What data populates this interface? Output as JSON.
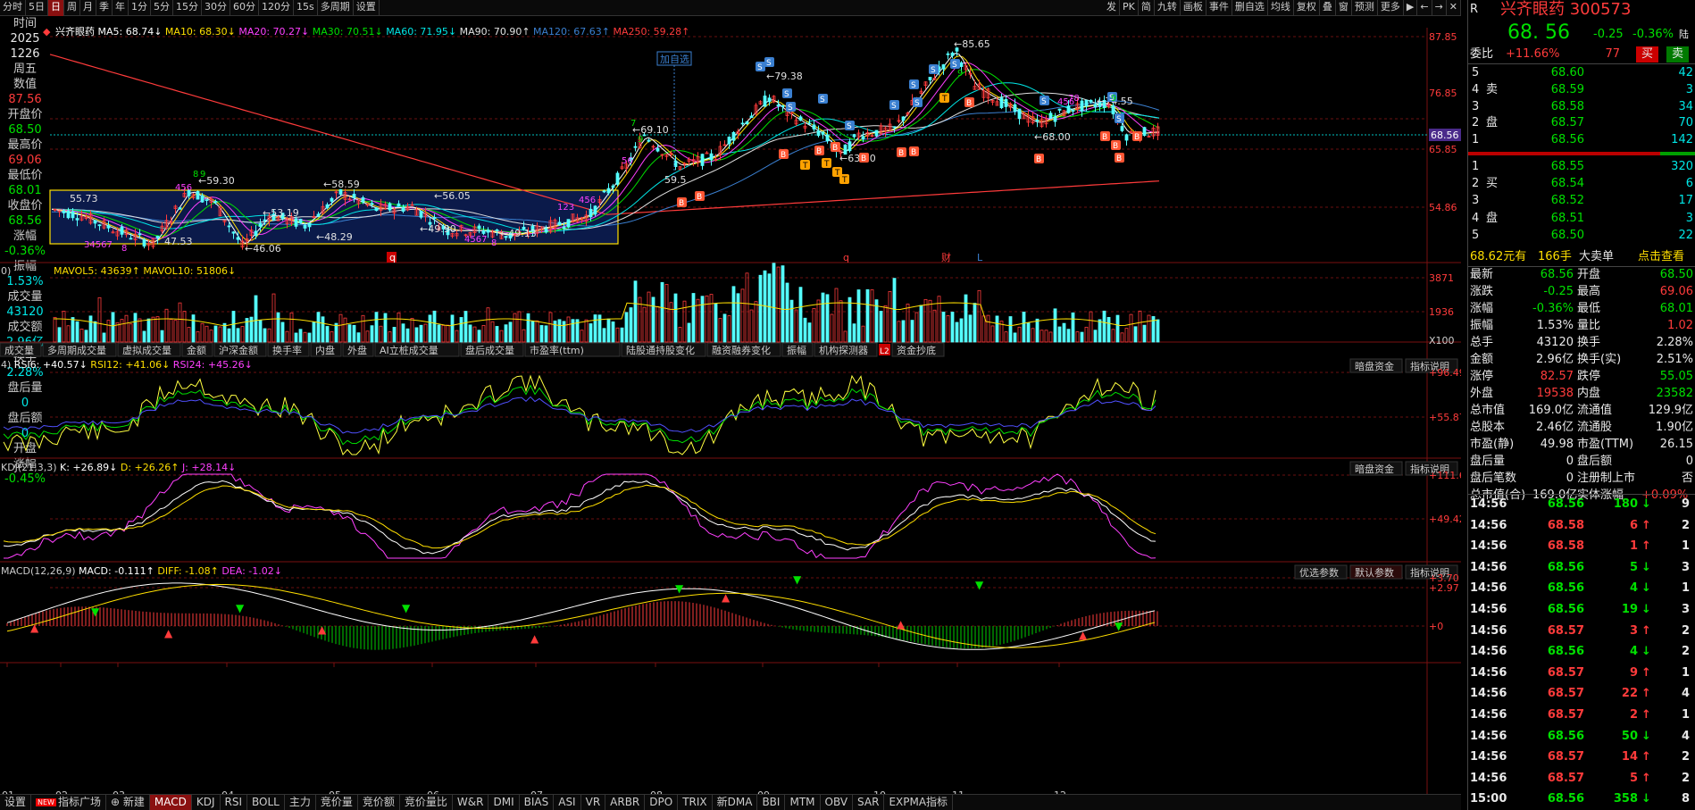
{
  "toolbar": {
    "items": [
      "分时",
      "5日",
      "日",
      "周",
      "月",
      "季",
      "年",
      "1分",
      "5分",
      "15分",
      "30分",
      "60分",
      "120分",
      "15s",
      "多周期",
      "设置"
    ],
    "active": "日",
    "right": [
      "发",
      "PK",
      "简",
      "九转",
      "画板",
      "事件",
      "删自选",
      "均线",
      "复权",
      "叠",
      "窗",
      "预测",
      "更多"
    ]
  },
  "leftcol": [
    {
      "l": "时间",
      "v": "2025"
    },
    {
      "l": "",
      "v": "1226"
    },
    {
      "l": "周五",
      "v": ""
    },
    {
      "l": "数值",
      "v": "87.56",
      "vc": "red"
    },
    {
      "l": "开盘价",
      "v": "68.50",
      "vc": "grn"
    },
    {
      "l": "最高价",
      "v": "69.06",
      "vc": "red"
    },
    {
      "l": "最低价",
      "v": "68.01",
      "vc": "grn"
    },
    {
      "l": "收盘价",
      "v": "68.56",
      "vc": "grn"
    },
    {
      "l": "涨幅",
      "v": "-0.36%",
      "vc": "grn"
    },
    {
      "l": "振幅",
      "v": "1.53%",
      "vc": "cyn"
    },
    {
      "l": "成交量",
      "v": "43120",
      "vc": "cyn"
    },
    {
      "l": "成交额",
      "v": "2.96亿",
      "vc": "cyn"
    },
    {
      "l": "换手",
      "v": "2.28%",
      "vc": "cyn"
    },
    {
      "l": "盘后量",
      "v": "0",
      "vc": "cyn"
    },
    {
      "l": "盘后额",
      "v": "0",
      "vc": "cyn"
    },
    {
      "l": "开盘",
      "v": ""
    },
    {
      "l": "涨幅",
      "v": "-0.45%",
      "vc": "grn"
    }
  ],
  "main": {
    "name": "兴齐眼药",
    "ma": [
      {
        "t": "MA5: 68.74↓",
        "c": "#ffffff"
      },
      {
        "t": "MA10: 68.30↓",
        "c": "#ffdf00"
      },
      {
        "t": "MA20: 70.27↓",
        "c": "#ff40ff"
      },
      {
        "t": "MA30: 70.51↓",
        "c": "#00e000"
      },
      {
        "t": "MA60: 71.95↓",
        "c": "#00e6e6"
      },
      {
        "t": "MA90: 70.90↑",
        "c": "#e0e0e0"
      },
      {
        "t": "MA120: 67.63↑",
        "c": "#3a7fd0"
      },
      {
        "t": "MA250: 59.28↑",
        "c": "#ff3b3b"
      }
    ],
    "yticks": [
      "87.85",
      "76.85",
      "65.85",
      "54.86"
    ],
    "price_tag": "68.56",
    "add_fav": "加自选",
    "annotations": [
      {
        "t": "←85.65",
        "x": 1068,
        "y": 44
      },
      {
        "t": "←79.38",
        "x": 858,
        "y": 80
      },
      {
        "t": "←74.55",
        "x": 1228,
        "y": 108
      },
      {
        "t": "←69.10",
        "x": 708,
        "y": 140
      },
      {
        "t": "←68.00",
        "x": 1158,
        "y": 148
      },
      {
        "t": "←63.60",
        "x": 940,
        "y": 172
      },
      {
        "t": "←59.30",
        "x": 222,
        "y": 197
      },
      {
        "t": "←58.59",
        "x": 362,
        "y": 201
      },
      {
        "t": "←56.05",
        "x": 486,
        "y": 214
      },
      {
        "t": "55.73",
        "x": 78,
        "y": 217
      },
      {
        "t": "←53.19",
        "x": 294,
        "y": 233
      },
      {
        "t": "←49.90",
        "x": 470,
        "y": 251
      },
      {
        "t": "←49.13",
        "x": 560,
        "y": 256
      },
      {
        "t": "←48.29",
        "x": 354,
        "y": 260
      },
      {
        "t": "47.53",
        "x": 184,
        "y": 265
      },
      {
        "t": "←46.06",
        "x": 274,
        "y": 273
      },
      {
        "t": "59.5",
        "x": 744,
        "y": 196
      }
    ],
    "events": [
      {
        "t": "q",
        "x": 436
      },
      {
        "t": "q",
        "x": 944
      },
      {
        "t": "财",
        "x": 1054
      },
      {
        "t": "L",
        "x": 1094
      }
    ]
  },
  "vol": {
    "label": "MAVOL5: 43639↑  MAVOL10: 51806↓",
    "yticks": [
      "3871",
      "1936",
      "X100"
    ]
  },
  "vtabs": [
    "多周期成交量",
    "虚拟成交量",
    "金额",
    "沪深金额",
    "换手率",
    "内盘",
    "外盘",
    "AI立桩成交量",
    "盘后成交量",
    "市盈率(ttm)",
    "陆股通持股变化",
    "融资融券变化",
    "振幅",
    "机构探测器",
    "资金抄底"
  ],
  "vtab_first": "成交量",
  "rsi": {
    "label0": "4)",
    "l1": "RSI6: +40.57↓",
    "l2": "RSI12: +41.06↓",
    "l3": "RSI24: +45.26↓",
    "yticks": [
      "+96.49",
      "+55.87"
    ],
    "btns": [
      "暗盘资金",
      "指标说明"
    ]
  },
  "kdj": {
    "label0": "KDJ(21,3,3)",
    "l1": "K: +26.89↓",
    "l2": "D: +26.26↑",
    "l3": "J: +28.14↓",
    "yticks": [
      "+111.6",
      "+49.42"
    ],
    "btns": [
      "暗盘资金",
      "指标说明"
    ]
  },
  "macd": {
    "label0": "MACD(12,26,9)",
    "l1": "MACD: -0.111↑",
    "l2": "DIFF: -1.08↑",
    "l3": "DEA: -1.02↓",
    "yticks": [
      "+3.70",
      "+2.97",
      "+0"
    ],
    "btns": [
      "优选参数",
      "默认参数",
      "指标说明"
    ]
  },
  "xaxis": [
    "01",
    "02",
    "03",
    "04",
    "05",
    "06",
    "07",
    "08",
    "09",
    "10",
    "11",
    "12"
  ],
  "btabs": [
    "设置",
    "指标广场",
    "新建",
    "MACD",
    "KDJ",
    "RSI",
    "BOLL",
    "主力",
    "竞价量",
    "竞价额",
    "竞价量比",
    "W&R",
    "DMI",
    "BIAS",
    "ASI",
    "VR",
    "ARBR",
    "DPO",
    "TRIX",
    "新DMA",
    "BBI",
    "MTM",
    "OBV",
    "SAR",
    "EXPMA指标"
  ],
  "btab_active": "MACD",
  "quote": {
    "title": "兴齐眼药 300573",
    "price": "68. 56",
    "chg": "-0.25",
    "pct": "-0.36%",
    "flag": "陆",
    "weibi": "委比",
    "weibi_v": "+11.66%",
    "weibi_n": "77",
    "buy": "买",
    "sell": "卖",
    "sells": [
      {
        "p": "68.60",
        "v": "42"
      },
      {
        "p": "68.59",
        "v": "3"
      },
      {
        "p": "68.58",
        "v": "34"
      },
      {
        "p": "68.57",
        "v": "70"
      },
      {
        "p": "68.56",
        "v": "142"
      }
    ],
    "buys": [
      {
        "p": "68.55",
        "v": "320"
      },
      {
        "p": "68.54",
        "v": "6"
      },
      {
        "p": "68.52",
        "v": "17"
      },
      {
        "p": "68.51",
        "v": "3"
      },
      {
        "p": "68.50",
        "v": "22"
      }
    ],
    "sell_labels": [
      "卖",
      "",
      "盘"
    ],
    "buy_labels": [
      "买",
      "",
      "盘"
    ],
    "big": {
      "a": "68.62元有",
      "b": "166手",
      "c": "大卖单",
      "d": "点击查看"
    },
    "stats": [
      [
        "最新",
        "68.56",
        "g",
        "开盘",
        "68.50",
        "g"
      ],
      [
        "涨跌",
        "-0.25",
        "g",
        "最高",
        "69.06",
        "r"
      ],
      [
        "涨幅",
        "-0.36%",
        "g",
        "最低",
        "68.01",
        "g"
      ],
      [
        "振幅",
        "1.53%",
        "w",
        "量比",
        "1.02",
        "r"
      ],
      [
        "总手",
        "43120",
        "w",
        "换手",
        "2.28%",
        "w"
      ],
      [
        "金额",
        "2.96亿",
        "w",
        "换手(实)",
        "2.51%",
        "w"
      ],
      [
        "涨停",
        "82.57",
        "r",
        "跌停",
        "55.05",
        "g"
      ],
      [
        "外盘",
        "19538",
        "r",
        "内盘",
        "23582",
        "g"
      ],
      [
        "总市值",
        "169.0亿",
        "w",
        "流通值",
        "129.9亿",
        "w"
      ],
      [
        "总股本",
        "2.46亿",
        "w",
        "流通股",
        "1.90亿",
        "w"
      ],
      [
        "市盈(静)",
        "49.98",
        "w",
        "市盈(TTM)",
        "26.15",
        "w"
      ],
      [
        "盘后量",
        "0",
        "w",
        "盘后额",
        "0",
        "w"
      ],
      [
        "盘后笔数",
        "0",
        "w",
        "注册制上市",
        "否",
        "w"
      ]
    ],
    "last_stat": {
      "a": "总市值(合)",
      "b": "169.0亿",
      "c": "实体涨幅",
      "d": "+0.09%"
    },
    "ticks": [
      [
        "14:56",
        "68.56",
        "180",
        "g",
        "9"
      ],
      [
        "14:56",
        "68.58",
        "6",
        "r",
        "2"
      ],
      [
        "14:56",
        "68.58",
        "1",
        "r",
        "1"
      ],
      [
        "14:56",
        "68.56",
        "5",
        "g",
        "3"
      ],
      [
        "14:56",
        "68.56",
        "4",
        "g",
        "1"
      ],
      [
        "14:56",
        "68.56",
        "19",
        "g",
        "3"
      ],
      [
        "14:56",
        "68.57",
        "3",
        "r",
        "2"
      ],
      [
        "14:56",
        "68.56",
        "4",
        "g",
        "2"
      ],
      [
        "14:56",
        "68.57",
        "9",
        "r",
        "1"
      ],
      [
        "14:56",
        "68.57",
        "22",
        "r",
        "4"
      ],
      [
        "14:56",
        "68.57",
        "2",
        "r",
        "1"
      ],
      [
        "14:56",
        "68.56",
        "50",
        "g",
        "4"
      ],
      [
        "14:56",
        "68.57",
        "14",
        "r",
        "2"
      ],
      [
        "14:56",
        "68.57",
        "5",
        "r",
        "2"
      ],
      [
        "15:00",
        "68.56",
        "358",
        "g",
        "8"
      ]
    ],
    "corner": "R"
  },
  "chart_data": {
    "type": "candlestick",
    "ylim": [
      44,
      88
    ],
    "current": 68.56,
    "ma250_end": 59.28
  }
}
